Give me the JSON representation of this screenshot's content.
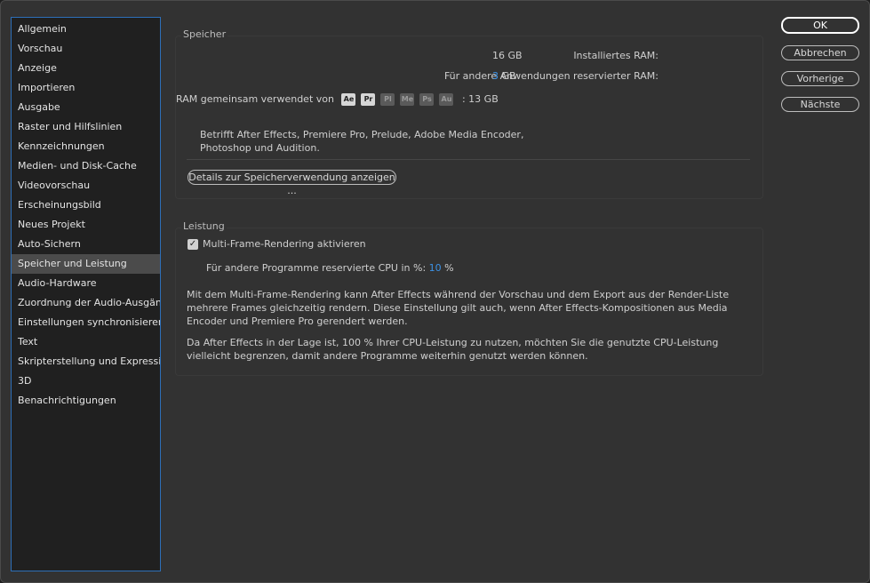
{
  "sidebar": {
    "items": [
      {
        "label": "Allgemein"
      },
      {
        "label": "Vorschau"
      },
      {
        "label": "Anzeige"
      },
      {
        "label": "Importieren"
      },
      {
        "label": "Ausgabe"
      },
      {
        "label": "Raster und Hilfslinien"
      },
      {
        "label": "Kennzeichnungen"
      },
      {
        "label": "Medien- und Disk-Cache"
      },
      {
        "label": "Videovorschau"
      },
      {
        "label": "Erscheinungsbild"
      },
      {
        "label": "Neues Projekt"
      },
      {
        "label": "Auto-Sichern"
      },
      {
        "label": "Speicher und Leistung"
      },
      {
        "label": "Audio-Hardware"
      },
      {
        "label": "Zuordnung der Audio-Ausgänge"
      },
      {
        "label": "Einstellungen synchronisieren"
      },
      {
        "label": "Text"
      },
      {
        "label": "Skripterstellung und Expressions"
      },
      {
        "label": "3D"
      },
      {
        "label": "Benachrichtigungen"
      }
    ],
    "selected": "Speicher und Leistung"
  },
  "memory": {
    "title": "Speicher",
    "installed_label": "Installiertes RAM:",
    "installed_value": "16 GB",
    "reserved_label": "Für andere Anwendungen reservierter RAM:",
    "reserved_value": "3",
    "reserved_unit": "GB",
    "shared_label": "RAM gemeinsam verwendet von",
    "apps": [
      {
        "abbr": "Ae",
        "active": true
      },
      {
        "abbr": "Pr",
        "active": true
      },
      {
        "abbr": "Pl",
        "active": false
      },
      {
        "abbr": "Me",
        "active": false
      },
      {
        "abbr": "Ps",
        "active": false
      },
      {
        "abbr": "Au",
        "active": false
      }
    ],
    "shared_value": ": 13 GB",
    "note_line1": "Betrifft After Effects, Premiere Pro, Prelude, Adobe Media Encoder,",
    "note_line2": "Photoshop und Audition.",
    "details_button": "Details zur Speicherverwendung anzeigen ..."
  },
  "performance": {
    "title": "Leistung",
    "mfr_checkbox_label": "Multi-Frame-Rendering aktivieren",
    "mfr_checked": true,
    "cpu_label": "Für andere Programme reservierte CPU in %:",
    "cpu_value": "10",
    "cpu_unit": "%",
    "para1_line1": "Mit dem Multi-Frame-Rendering kann After Effects während der Vorschau und dem Export aus der Render-Liste",
    "para1_line2": "mehrere Frames gleichzeitig rendern. Diese Einstellung gilt auch, wenn After Effects-Kompositionen aus Media",
    "para1_line3": "Encoder und Premiere Pro gerendert werden.",
    "para2_line1": "Da After Effects in der Lage ist, 100 % Ihrer CPU-Leistung zu nutzen, möchten Sie die genutzte CPU-Leistung",
    "para2_line2": "vielleicht begrenzen, damit andere Programme weiterhin genutzt werden können."
  },
  "buttons": {
    "ok": "OK",
    "cancel": "Abbrechen",
    "previous": "Vorherige",
    "next": "Nächste"
  },
  "colors": {
    "accent": "#3c92e6",
    "sidebar_border": "#2d6fb8",
    "dialog_bg": "#323232"
  }
}
